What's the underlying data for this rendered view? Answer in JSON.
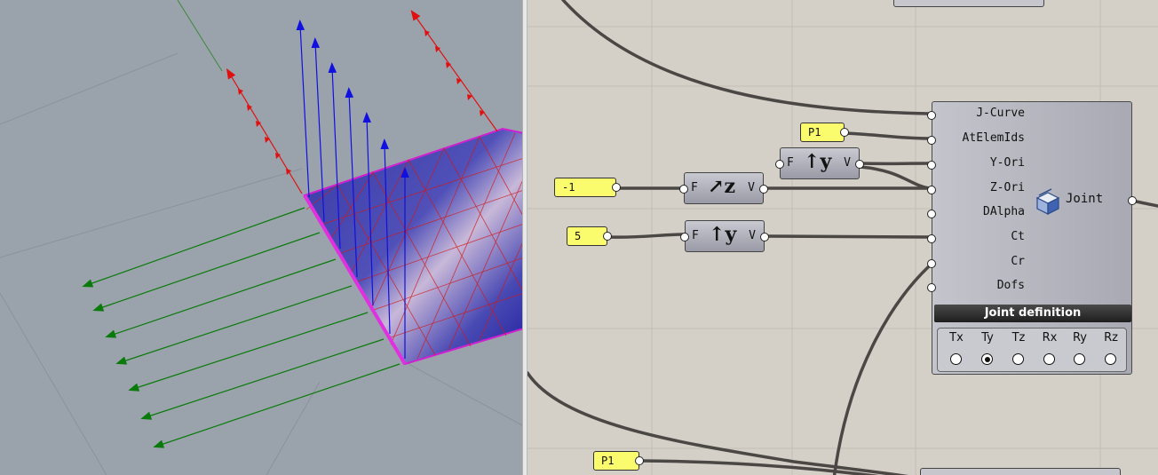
{
  "panels": {
    "p1_top": "P1",
    "minus_one": "-1",
    "five": "5",
    "p1_bottom": "P1"
  },
  "vector_components": {
    "vz": {
      "input": "F",
      "icon": "z",
      "output": "V"
    },
    "vy_top": {
      "input": "F",
      "icon": "y",
      "output": "V"
    },
    "vy_bottom": {
      "input": "F",
      "icon": "y",
      "output": "V"
    }
  },
  "joint": {
    "inputs": [
      "J-Curve",
      "AtElemIds",
      "Y-Ori",
      "Z-Ori",
      "DAlpha",
      "Ct",
      "Cr",
      "Dofs"
    ],
    "output": "Joint",
    "title": "Joint definition",
    "dofs": [
      "Tx",
      "Ty",
      "Tz",
      "Rx",
      "Ry",
      "Rz"
    ],
    "selected_dof": "Ty",
    "icon": "joint-cube-icon"
  },
  "colors": {
    "viewport_bg": "#9aa3ac",
    "canvas_bg": "#d4d0c8",
    "panel_yellow": "#fbfb6e",
    "arrow_blue": "#1010e0",
    "arrow_red": "#e01010",
    "arrow_green": "#0a7a0a",
    "mesh_magenta": "#d020d0"
  }
}
